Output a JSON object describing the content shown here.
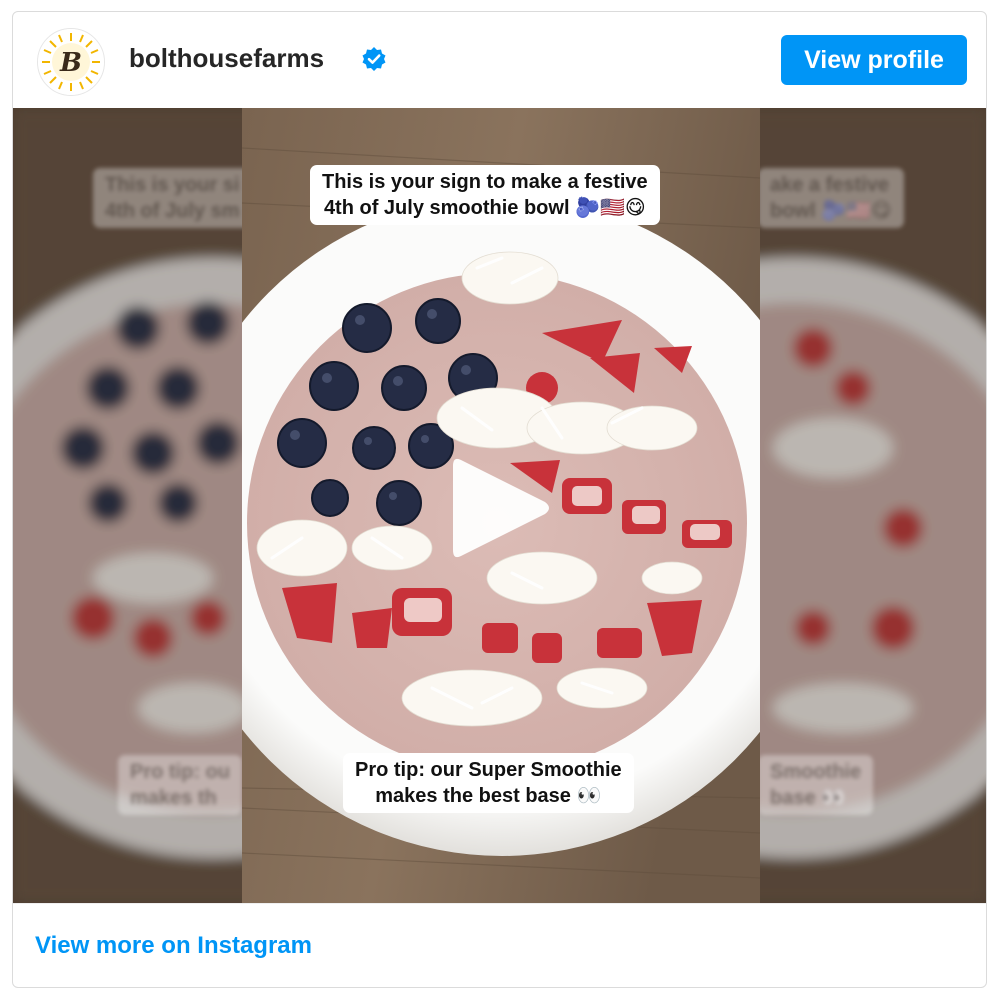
{
  "header": {
    "username": "bolthousefarms",
    "verified": true,
    "view_profile_label": "View profile",
    "avatar_letter": "B"
  },
  "media": {
    "type": "video",
    "caption_top_line1": "This is your sign to make a festive",
    "caption_top_line2": "4th of July smoothie bowl 🫐🇺🇸😋",
    "caption_bottom_line1": "Pro tip: our Super Smoothie",
    "caption_bottom_line2": "makes the best base 👀",
    "play_icon": "play-icon"
  },
  "footer": {
    "link_label": "View more on Instagram"
  },
  "colors": {
    "brand_blue": "#0095f6",
    "verified_blue": "#0095f6",
    "avatar_gold": "#f2b600",
    "table_wood": "#6b5644",
    "smoothie": "#dcbcb6"
  }
}
